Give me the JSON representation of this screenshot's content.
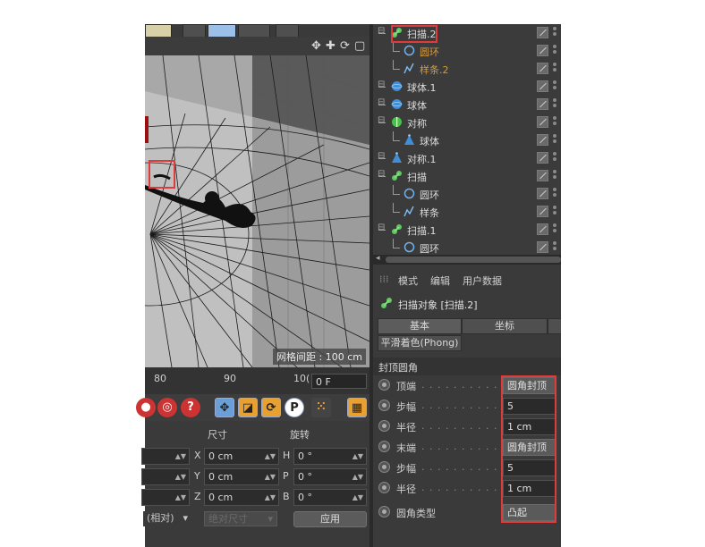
{
  "viewport": {
    "grid_spacing_label": "网格间距 : 100 cm"
  },
  "timeline": {
    "ticks": [
      "80",
      "90",
      "10("
    ],
    "frame_value": "0 F"
  },
  "coordinates": {
    "headers": {
      "size": "尺寸",
      "rotation": "旋转"
    },
    "rows": [
      {
        "size_axis": "X",
        "size_value": "0 cm",
        "rot_axis": "H",
        "rot_value": "0 °"
      },
      {
        "size_axis": "Y",
        "size_value": "0 cm",
        "rot_axis": "P",
        "rot_value": "0 °"
      },
      {
        "size_axis": "Z",
        "size_value": "0 cm",
        "rot_axis": "B",
        "rot_value": "0 °"
      }
    ],
    "mode_dropdown": "(相对)",
    "size_dropdown": "绝对尺寸",
    "apply_button": "应用"
  },
  "objects": [
    {
      "name": "扫描.2",
      "type": "sweep",
      "color": "normal",
      "depth": 0
    },
    {
      "name": "圆环",
      "type": "circle",
      "color": "orange",
      "depth": 1
    },
    {
      "name": "样条.2",
      "type": "spline",
      "color": "orange",
      "depth": 1
    },
    {
      "name": "球体.1",
      "type": "sphere",
      "color": "normal",
      "depth": 0
    },
    {
      "name": "球体",
      "type": "sphere",
      "color": "normal",
      "depth": 0
    },
    {
      "name": "对称",
      "type": "symmetry",
      "color": "normal",
      "depth": 0
    },
    {
      "name": "球体",
      "type": "pyramid",
      "color": "normal",
      "depth": 1
    },
    {
      "name": "对称.1",
      "type": "pyramid",
      "color": "normal",
      "depth": 0
    },
    {
      "name": "扫描",
      "type": "sweep",
      "color": "normal",
      "depth": 0
    },
    {
      "name": "圆环",
      "type": "circle",
      "color": "normal",
      "depth": 1
    },
    {
      "name": "样条",
      "type": "spline",
      "color": "normal",
      "depth": 1
    },
    {
      "name": "扫描.1",
      "type": "sweep",
      "color": "normal",
      "depth": 0
    },
    {
      "name": "圆环",
      "type": "circle",
      "color": "normal",
      "depth": 1
    }
  ],
  "attributes": {
    "menu": [
      "模式",
      "编辑",
      "用户数据"
    ],
    "object_title": "扫描对象 [扫描.2]",
    "tabs": [
      "基本",
      "坐标"
    ],
    "phong_tab": "平滑着色(Phong)",
    "section": "封顶圆角",
    "params": [
      {
        "label": "顶端",
        "value": "圆角封顶",
        "kind": "dropdown"
      },
      {
        "label": "步幅",
        "value": "5",
        "kind": "number"
      },
      {
        "label": "半径",
        "value": "1 cm",
        "kind": "number"
      },
      {
        "label": "末端",
        "value": "圆角封顶",
        "kind": "dropdown"
      },
      {
        "label": "步幅",
        "value": "5",
        "kind": "number"
      },
      {
        "label": "半径",
        "value": "1 cm",
        "kind": "number"
      },
      {
        "label": "圆角类型",
        "value": "凸起",
        "kind": "dropdown"
      }
    ]
  },
  "colors": {
    "highlight": "#e23a3a",
    "panel": "#3a3a3a",
    "orange_text": "#d89a3a"
  }
}
